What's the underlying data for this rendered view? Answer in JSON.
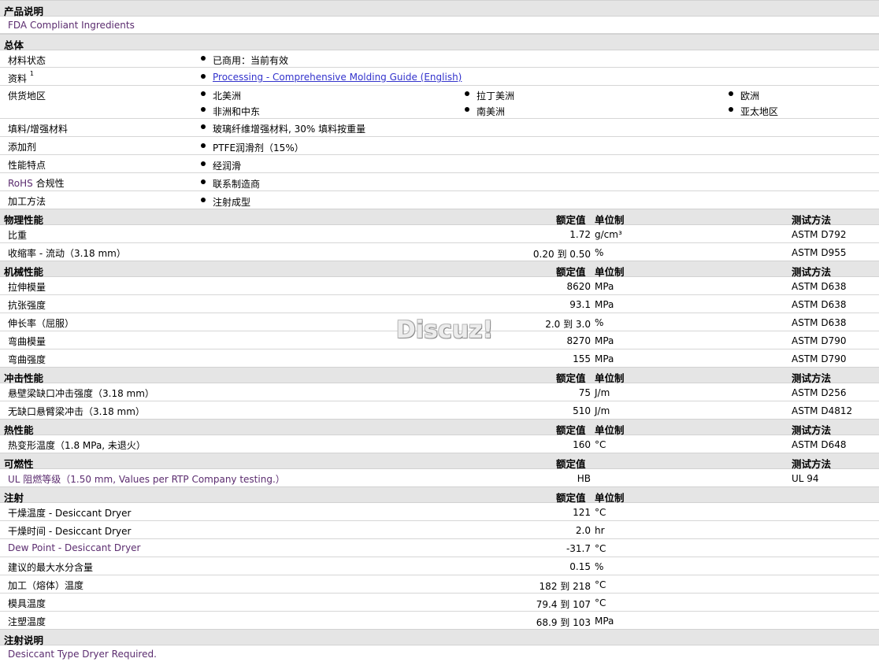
{
  "s_product": "产品说明",
  "product_note": "FDA Compliant Ingredients",
  "s_general": "总体",
  "general": {
    "material_status_label": "材料状态",
    "material_status": "已商用：当前有效",
    "docs_label": "资料",
    "docs_sup": "1",
    "docs_link": "Processing - Comprehensive Molding Guide (English)",
    "supply_label": "供货地区",
    "supply": [
      "北美洲",
      "拉丁美洲",
      "欧洲",
      "非洲和中东",
      "南美洲",
      "亚太地区"
    ],
    "filler_label": "填料/增强材料",
    "filler": "玻璃纤维增强材料, 30% 填料按重量",
    "additive_label": "添加剂",
    "additive": "PTFE润滑剂（15%）",
    "feature_label": "性能特点",
    "feature": "经润滑",
    "rohs_label_en": "RoHS",
    "rohs_label_zh": " 合规性",
    "rohs": "联系制造商",
    "process_label": "加工方法",
    "process": "注射成型"
  },
  "headers": {
    "nominal": "额定值",
    "unit": "单位制",
    "method": "测试方法"
  },
  "s_physical": "物理性能",
  "physical": [
    {
      "label": "比重",
      "val": "1.72",
      "unit": "g/cm³",
      "method": "ASTM D792"
    },
    {
      "label": "收缩率  - 流动（3.18 mm）",
      "val": "0.20 到  0.50",
      "unit": "%",
      "method": "ASTM D955"
    }
  ],
  "s_mechanical": "机械性能",
  "mechanical": [
    {
      "label": "拉伸模量",
      "val": "8620",
      "unit": "MPa",
      "method": "ASTM D638"
    },
    {
      "label": "抗张强度",
      "val": "93.1",
      "unit": "MPa",
      "method": "ASTM D638"
    },
    {
      "label": "伸长率（屈服）",
      "val": "2.0 到  3.0",
      "unit": "%",
      "method": "ASTM D638"
    },
    {
      "label": "弯曲模量",
      "val": "8270",
      "unit": "MPa",
      "method": "ASTM D790"
    },
    {
      "label": "弯曲强度",
      "val": "155",
      "unit": "MPa",
      "method": "ASTM D790"
    }
  ],
  "s_impact": "冲击性能",
  "impact": [
    {
      "label": "悬壁梁缺口冲击强度（3.18 mm）",
      "val": "75",
      "unit": "J/m",
      "method": "ASTM D256"
    },
    {
      "label": "无缺口悬臂梁冲击（3.18 mm）",
      "val": "510",
      "unit": "J/m",
      "method": "ASTM D4812"
    }
  ],
  "s_thermal": "热性能",
  "thermal": [
    {
      "label": "热变形温度（1.8 MPa, 未退火）",
      "val": "160",
      "unit": "°C",
      "method": "ASTM D648"
    }
  ],
  "s_flammability": "可燃性",
  "flammability": [
    {
      "label": "UL 阻燃等级（1.50 mm, Values per RTP Company testing.）",
      "val": "HB",
      "unit": "",
      "method": "UL 94"
    }
  ],
  "s_injection": "注射",
  "injection": [
    {
      "label": "干燥温度  - Desiccant Dryer",
      "val": "121",
      "unit": "°C"
    },
    {
      "label": "干燥时间  - Desiccant Dryer",
      "val": "2.0",
      "unit": "hr"
    },
    {
      "label": "Dew Point - Desiccant Dryer",
      "val": "-31.7",
      "unit": "°C"
    },
    {
      "label": "建议的最大水分含量",
      "val": "0.15",
      "unit": "%"
    },
    {
      "label": "加工（熔体）温度",
      "val": "182 到  218",
      "unit": "°C"
    },
    {
      "label": "模具温度",
      "val": "79.4 到  107",
      "unit": "°C"
    },
    {
      "label": "注塑温度",
      "val": "68.9 到  103",
      "unit": "MPa"
    }
  ],
  "s_injection_note": "注射说明",
  "injection_note": "Desiccant Type Dryer Required.",
  "watermark": "Discuz!"
}
